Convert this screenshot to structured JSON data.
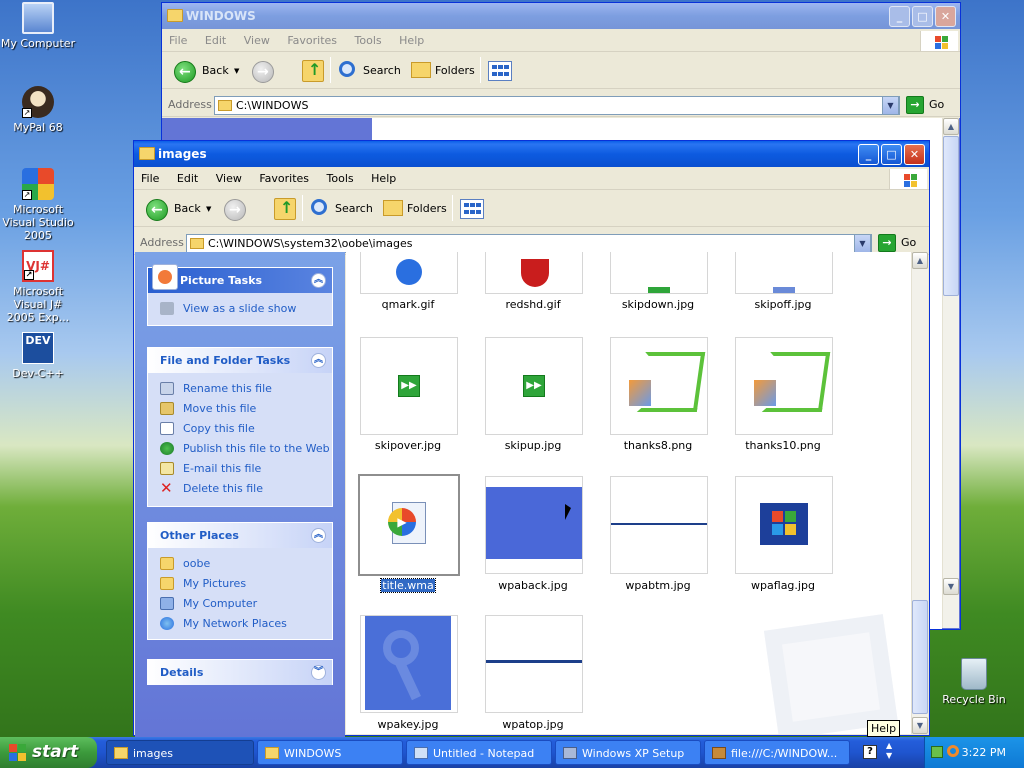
{
  "desktop": {
    "icons": [
      {
        "label": "My Computer"
      },
      {
        "label": "MyPal 68"
      },
      {
        "label": "Microsoft Visual Studio 2005"
      },
      {
        "label": "Microsoft Visual J# 2005 Exp..."
      },
      {
        "label": "Dev-C++"
      },
      {
        "label": "Recycle Bin"
      }
    ]
  },
  "back_window": {
    "title": "WINDOWS",
    "menu": [
      "File",
      "Edit",
      "View",
      "Favorites",
      "Tools",
      "Help"
    ],
    "toolbar": {
      "back": "Back",
      "search": "Search",
      "folders": "Folders"
    },
    "address_label": "Address",
    "address": "C:\\WINDOWS",
    "go": "Go"
  },
  "front_window": {
    "title": "images",
    "menu": [
      "File",
      "Edit",
      "View",
      "Favorites",
      "Tools",
      "Help"
    ],
    "toolbar": {
      "back": "Back",
      "search": "Search",
      "folders": "Folders"
    },
    "address_label": "Address",
    "address": "C:\\WINDOWS\\system32\\oobe\\images",
    "go": "Go",
    "picture_tasks": {
      "title": "Picture Tasks",
      "items": [
        "View as a slide show"
      ]
    },
    "file_tasks": {
      "title": "File and Folder Tasks",
      "items": [
        "Rename this file",
        "Move this file",
        "Copy this file",
        "Publish this file to the Web",
        "E-mail this file",
        "Delete this file"
      ]
    },
    "other_places": {
      "title": "Other Places",
      "items": [
        "oobe",
        "My Pictures",
        "My Computer",
        "My Network Places"
      ]
    },
    "details": {
      "title": "Details"
    },
    "files": [
      "qmark.gif",
      "redshd.gif",
      "skipdown.jpg",
      "skipoff.jpg",
      "skipover.jpg",
      "skipup.jpg",
      "thanks8.png",
      "thanks10.png",
      "title.wma",
      "wpaback.jpg",
      "wpabtm.jpg",
      "wpaflag.jpg",
      "wpakey.jpg",
      "wpatop.jpg"
    ],
    "selected_file": "title.wma"
  },
  "taskbar": {
    "start": "start",
    "items": [
      "images",
      "WINDOWS",
      "Untitled - Notepad",
      "Windows XP Setup",
      "file:///C:/WINDOW..."
    ],
    "active_item": "images",
    "clock": "3:22 PM"
  },
  "tooltip": "Help"
}
